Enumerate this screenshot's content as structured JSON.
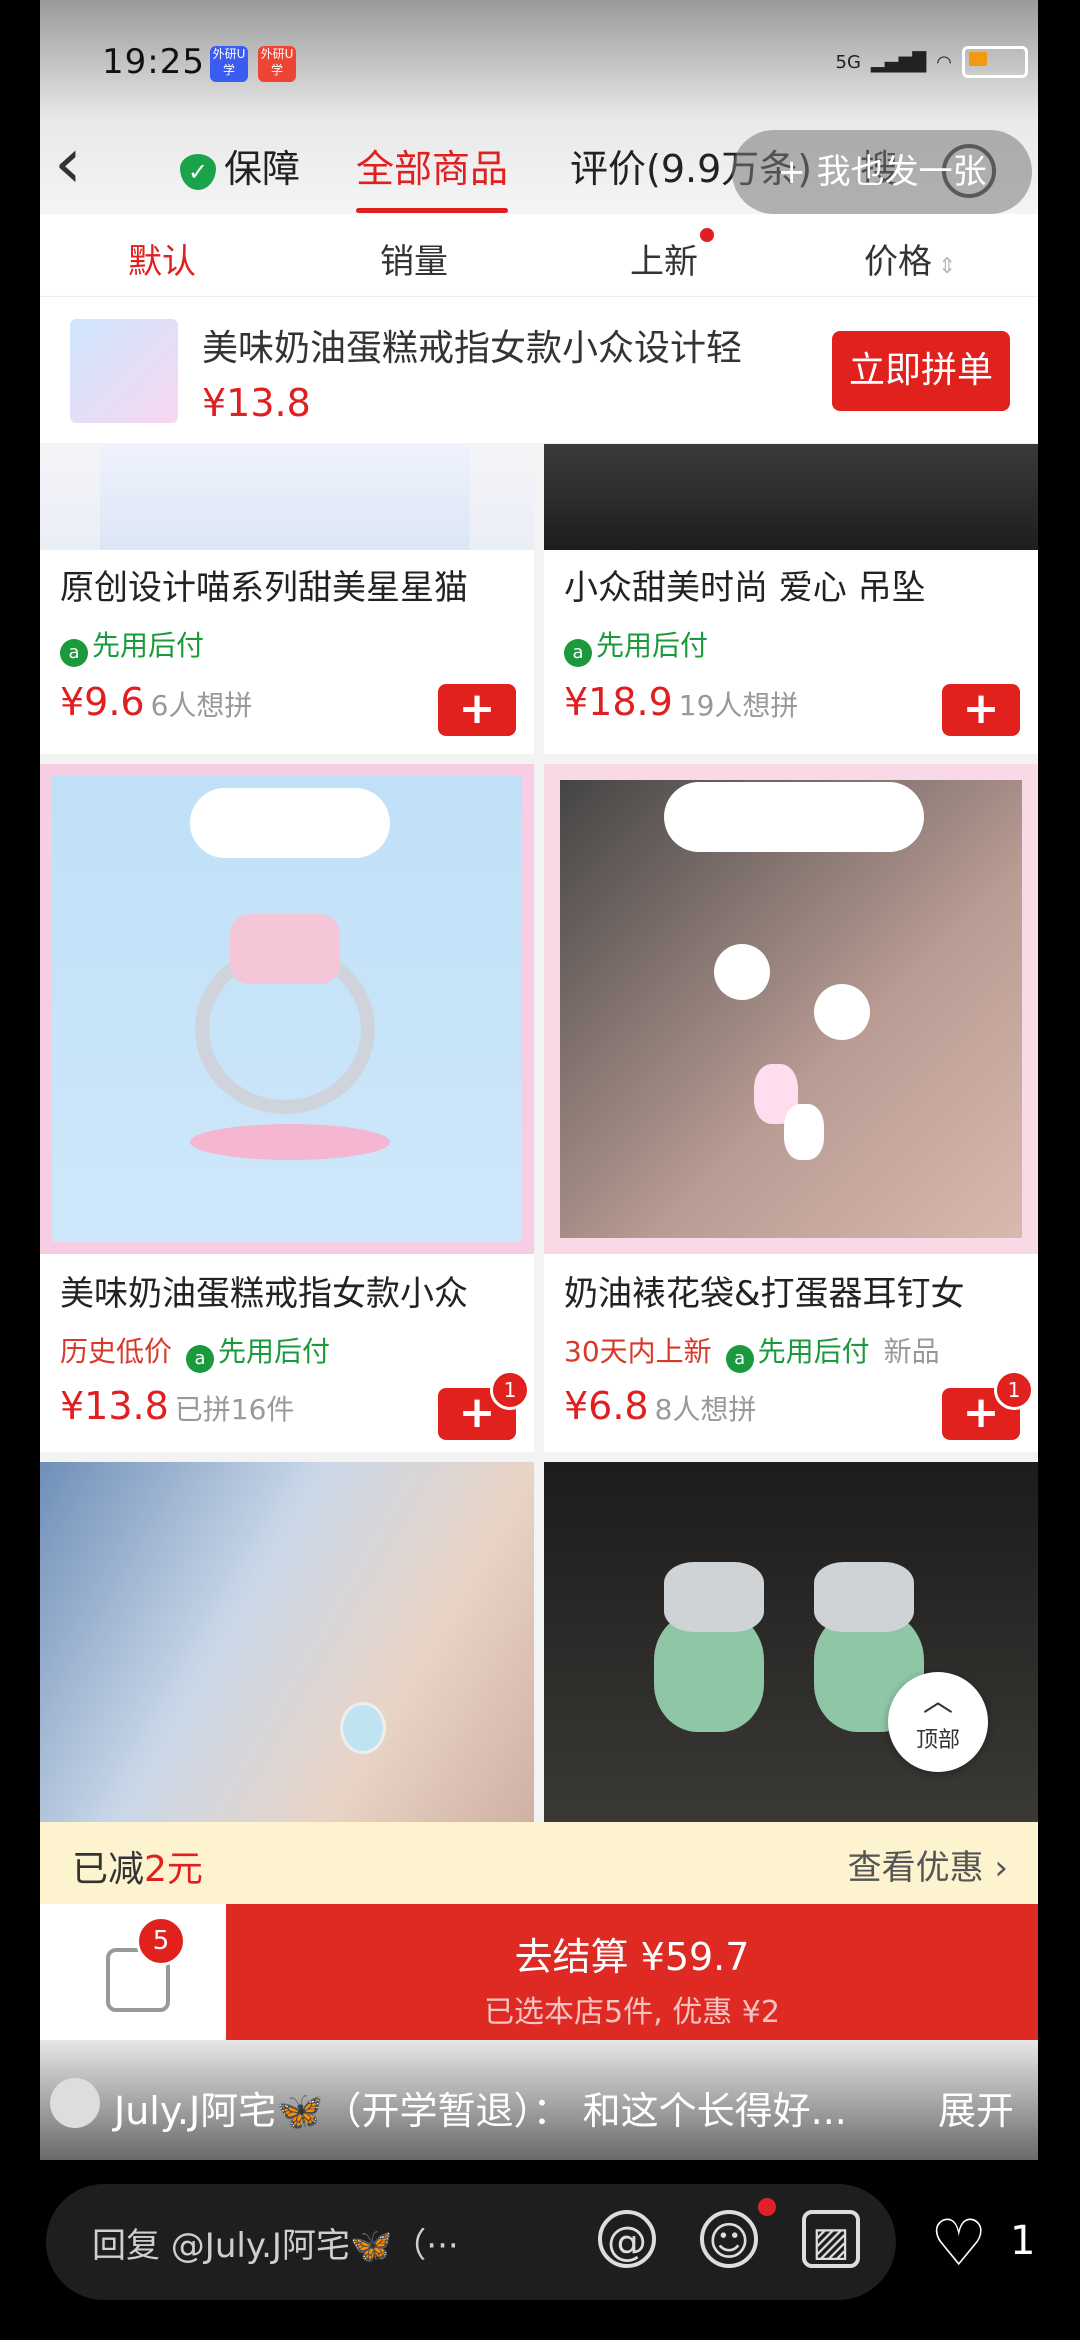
{
  "status_bar": {
    "time": "19:25",
    "app_icon_1": "外研U学",
    "app_icon_2": "外研U学",
    "network": "5G"
  },
  "nav": {
    "guarantee_label": "保障",
    "tabs": [
      "全部商品",
      "评价(9.9万条)",
      "搜"
    ],
    "overlay_button": "+ 我也发一张"
  },
  "sort": {
    "items": [
      "默认",
      "销量",
      "上新",
      "价格"
    ]
  },
  "banner": {
    "title": "美味奶油蛋糕戒指女款小众设计轻",
    "price": "¥13.8",
    "button": "立即拼单"
  },
  "cards": [
    {
      "title": "原创设计喵系列甜美星星猫",
      "tags": [
        "先用后付"
      ],
      "price": "¥9.6",
      "sub": "6人想拼",
      "badge": ""
    },
    {
      "title": "小众甜美时尚  爱心  吊坠",
      "tags": [
        "先用后付"
      ],
      "price": "¥18.9",
      "sub": "19人想拼",
      "badge": ""
    },
    {
      "title": "美味奶油蛋糕戒指女款小众",
      "red_tag": "历史低价",
      "tags": [
        "先用后付"
      ],
      "price": "¥13.8",
      "sub": "已拼16件",
      "badge": "1"
    },
    {
      "title": "奶油裱花袋&打蛋器耳钉女",
      "red_tag": "30天内上新",
      "tags": [
        "先用后付"
      ],
      "grey_tag": "新品",
      "price": "¥6.8",
      "sub": "8人想拼",
      "badge": "1"
    }
  ],
  "top_button": {
    "label": "顶部"
  },
  "discount": {
    "prefix": "已减",
    "amount": "2元",
    "link": "查看优惠"
  },
  "checkout": {
    "bag_count": "5",
    "main": "去结算 ¥59.7",
    "sub": "已选本店5件, 优惠 ¥2"
  },
  "comment": {
    "author": "July.J阿宅🦋（开学暂退）：",
    "text": "和这个长得好...",
    "expand": "展开"
  },
  "reply": {
    "placeholder": "回复 @July.J阿宅🦋（···",
    "like_count": "1"
  },
  "colors": {
    "accent": "#e02020",
    "green": "#1a9a3c",
    "discount_bg": "#fdf3cf"
  }
}
